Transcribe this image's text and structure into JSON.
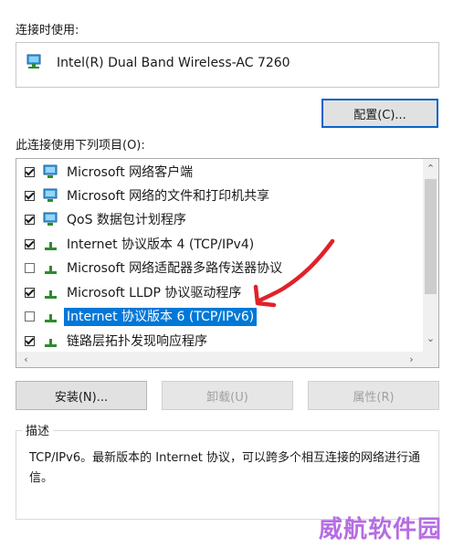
{
  "connect_using_label": "连接时使用:",
  "adapter": {
    "name": "Intel(R) Dual Band Wireless-AC 7260",
    "icon": "network-adapter-icon"
  },
  "configure_button": "配置(C)...",
  "items_label": "此连接使用下列项目(O):",
  "items": [
    {
      "label": "Microsoft 网络客户端",
      "checked": true,
      "icon": "network-client-icon"
    },
    {
      "label": "Microsoft 网络的文件和打印机共享",
      "checked": true,
      "icon": "network-client-icon"
    },
    {
      "label": "QoS 数据包计划程序",
      "checked": true,
      "icon": "network-client-icon"
    },
    {
      "label": "Internet 协议版本 4 (TCP/IPv4)",
      "checked": true,
      "icon": "protocol-icon"
    },
    {
      "label": "Microsoft 网络适配器多路传送器协议",
      "checked": false,
      "icon": "protocol-icon"
    },
    {
      "label": "Microsoft LLDP 协议驱动程序",
      "checked": true,
      "icon": "protocol-icon"
    },
    {
      "label": "Internet 协议版本 6 (TCP/IPv6)",
      "checked": false,
      "icon": "protocol-icon",
      "selected": true
    },
    {
      "label": "链路层拓扑发现响应程序",
      "checked": true,
      "icon": "protocol-icon"
    }
  ],
  "buttons": {
    "install": "安装(N)...",
    "uninstall": "卸载(U)",
    "properties": "属性(R)"
  },
  "description": {
    "label": "描述",
    "text": "TCP/IPv6。最新版本的 Internet 协议，可以跨多个相互连接的网络进行通信。"
  },
  "watermark": "威航软件园",
  "colors": {
    "selection": "#0078d7",
    "annotation_arrow": "#e0222a",
    "watermark": "#b66de2",
    "focus_border": "#0a62c9"
  }
}
